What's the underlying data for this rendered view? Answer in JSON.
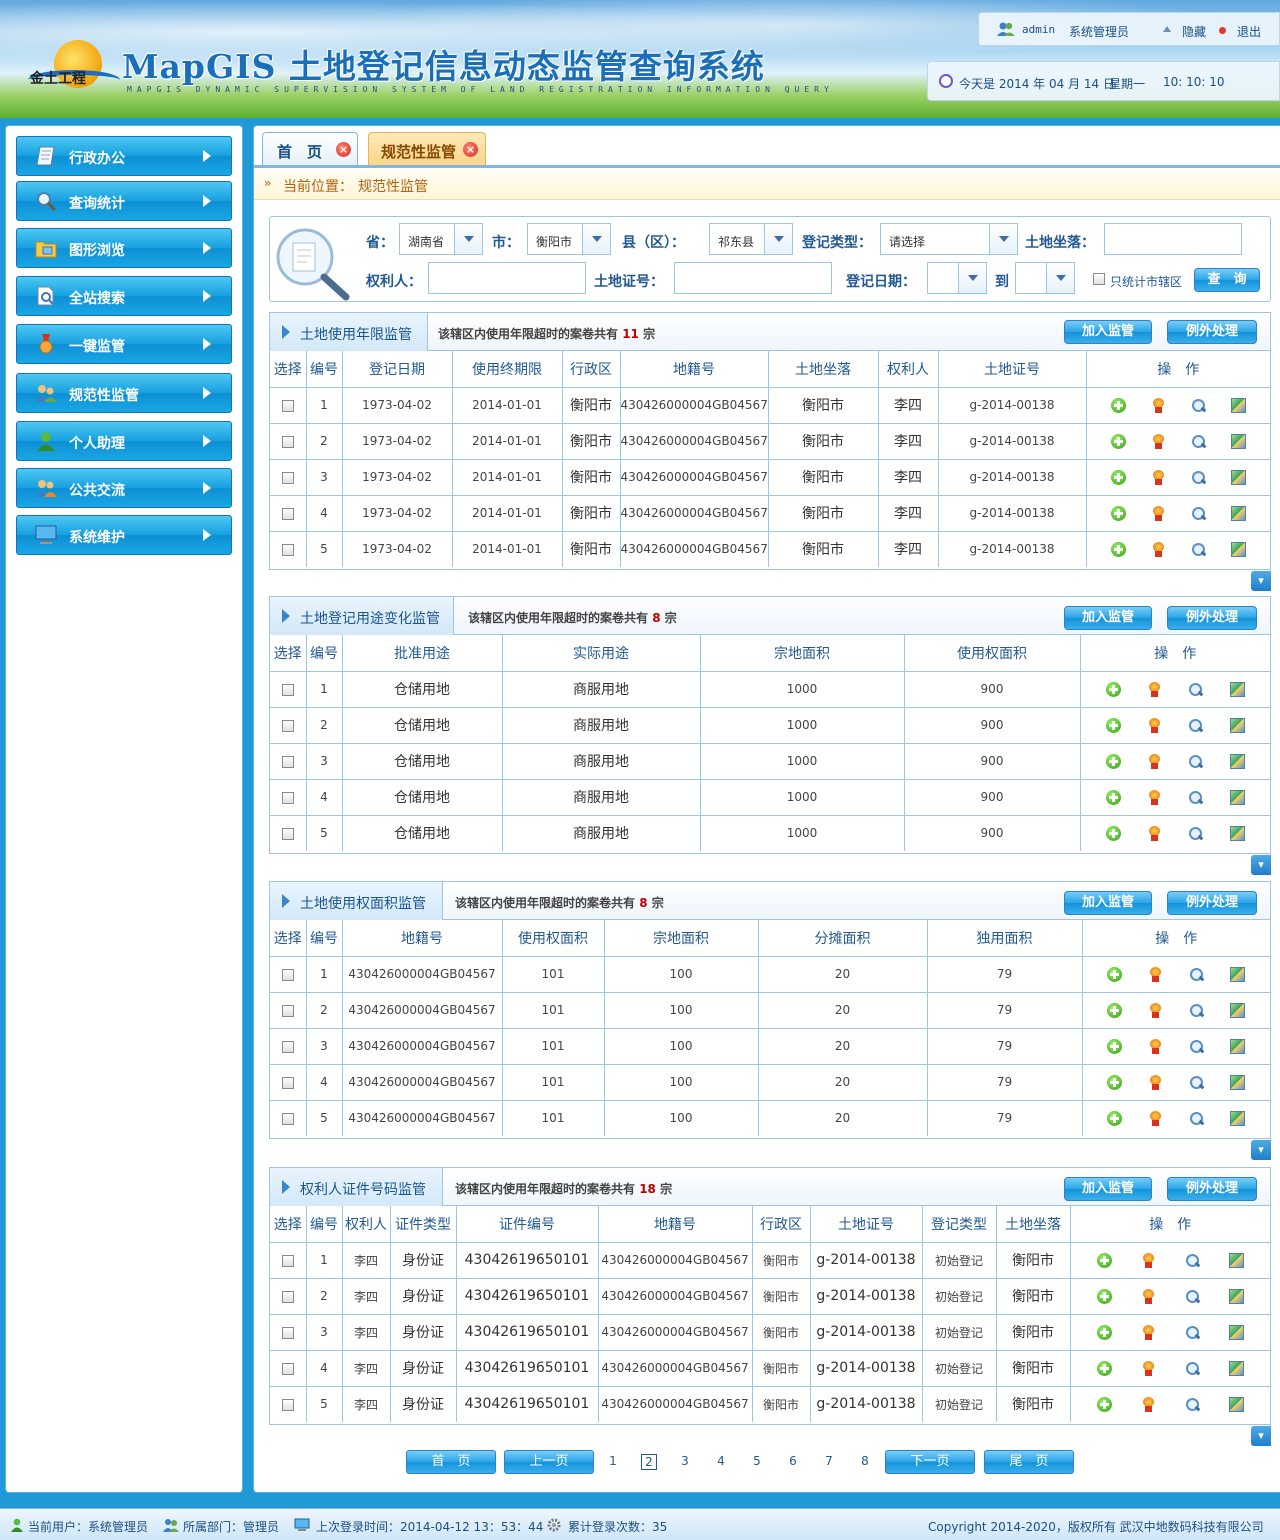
{
  "header": {
    "logo_text": "金土工程",
    "title": "MapGIS 土地登记信息动态监管查询系统",
    "subtitle": "MAPGIS DYNAMIC SUPERVISION SYSTEM OF LAND REGISTRATION INFORMATION QUERY",
    "user": "admin",
    "role": "系统管理员",
    "hide_label": "隐藏",
    "logout_label": "退出",
    "date_text": "今天是 2014 年 04 月 14 日",
    "weekday": "星期一",
    "time": "10: 10: 10"
  },
  "sidebar": {
    "items": [
      {
        "label": "行政办公",
        "icon": "document-icon"
      },
      {
        "label": "查询统计",
        "icon": "magnifier-icon"
      },
      {
        "label": "图形浏览",
        "icon": "folder-image-icon"
      },
      {
        "label": "全站搜索",
        "icon": "search-doc-icon"
      },
      {
        "label": "一键监管",
        "icon": "medal-icon"
      },
      {
        "label": "规范性监管",
        "icon": "users-icon"
      },
      {
        "label": "个人助理",
        "icon": "person-icon"
      },
      {
        "label": "公共交流",
        "icon": "group-icon"
      },
      {
        "label": "系统维护",
        "icon": "monitor-icon"
      }
    ]
  },
  "tabs": [
    {
      "label": "首　页"
    },
    {
      "label": "规范性监管"
    }
  ],
  "breadcrumb": {
    "prefix": "当前位置：",
    "current": "规范性监管"
  },
  "search": {
    "province_label": "省：",
    "province_value": "湖南省",
    "city_label": "市：",
    "city_value": "衡阳市",
    "county_label": "县（区）：",
    "county_value": "祁东县",
    "regtype_label": "登记类型：",
    "regtype_value": "请选择",
    "location_label": "土地坐落：",
    "owner_label": "权利人：",
    "cert_label": "土地证号：",
    "date_label": "登记日期：",
    "to_label": "到",
    "city_only_label": "只统计市辖区",
    "query_label": "查　询"
  },
  "panel_buttons": {
    "add": "加入监管",
    "exception": "例外处理"
  },
  "panels": [
    {
      "title": "土地使用年限监管",
      "info_prefix": "该辖区内使用年限超时的案卷共有",
      "count": "11",
      "info_suffix": "宗",
      "headers": [
        "选择",
        "编号",
        "登记日期",
        "使用终期限",
        "行政区",
        "地籍号",
        "土地坐落",
        "权利人",
        "土地证号",
        "操　作"
      ],
      "rows": [
        [
          "1",
          "1973-04-02",
          "2014-01-01",
          "衡阳市",
          "430426000004GB04567",
          "衡阳市",
          "李四",
          "g-2014-00138"
        ],
        [
          "2",
          "1973-04-02",
          "2014-01-01",
          "衡阳市",
          "430426000004GB04567",
          "衡阳市",
          "李四",
          "g-2014-00138"
        ],
        [
          "3",
          "1973-04-02",
          "2014-01-01",
          "衡阳市",
          "430426000004GB04567",
          "衡阳市",
          "李四",
          "g-2014-00138"
        ],
        [
          "4",
          "1973-04-02",
          "2014-01-01",
          "衡阳市",
          "430426000004GB04567",
          "衡阳市",
          "李四",
          "g-2014-00138"
        ],
        [
          "5",
          "1973-04-02",
          "2014-01-01",
          "衡阳市",
          "430426000004GB04567",
          "衡阳市",
          "李四",
          "g-2014-00138"
        ]
      ]
    },
    {
      "title": "土地登记用途变化监管",
      "info_prefix": "该辖区内使用年限超时的案卷共有",
      "count": "8",
      "info_suffix": "宗",
      "headers": [
        "选择",
        "编号",
        "批准用途",
        "实际用途",
        "宗地面积",
        "使用权面积",
        "操　作"
      ],
      "rows": [
        [
          "1",
          "仓储用地",
          "商服用地",
          "1000",
          "900"
        ],
        [
          "2",
          "仓储用地",
          "商服用地",
          "1000",
          "900"
        ],
        [
          "3",
          "仓储用地",
          "商服用地",
          "1000",
          "900"
        ],
        [
          "4",
          "仓储用地",
          "商服用地",
          "1000",
          "900"
        ],
        [
          "5",
          "仓储用地",
          "商服用地",
          "1000",
          "900"
        ]
      ]
    },
    {
      "title": "土地使用权面积监管",
      "info_prefix": "该辖区内使用年限超时的案卷共有",
      "count": "8",
      "info_suffix": "宗",
      "headers": [
        "选择",
        "编号",
        "地籍号",
        "使用权面积",
        "宗地面积",
        "分摊面积",
        "独用面积",
        "操　作"
      ],
      "rows": [
        [
          "1",
          "430426000004GB04567",
          "101",
          "100",
          "20",
          "79"
        ],
        [
          "2",
          "430426000004GB04567",
          "101",
          "100",
          "20",
          "79"
        ],
        [
          "3",
          "430426000004GB04567",
          "101",
          "100",
          "20",
          "79"
        ],
        [
          "4",
          "430426000004GB04567",
          "101",
          "100",
          "20",
          "79"
        ],
        [
          "5",
          "430426000004GB04567",
          "101",
          "100",
          "20",
          "79"
        ]
      ]
    },
    {
      "title": "权利人证件号码监管",
      "info_prefix": "该辖区内使用年限超时的案卷共有",
      "count": "18",
      "info_suffix": "宗",
      "headers": [
        "选择",
        "编号",
        "权利人",
        "证件类型",
        "证件编号",
        "地籍号",
        "行政区",
        "土地证号",
        "登记类型",
        "土地坐落",
        "操　作"
      ],
      "rows": [
        [
          "1",
          "李四",
          "身份证",
          "43042619650101",
          "430426000004GB04567",
          "衡阳市",
          "g-2014-00138",
          "初始登记",
          "衡阳市"
        ],
        [
          "2",
          "李四",
          "身份证",
          "43042619650101",
          "430426000004GB04567",
          "衡阳市",
          "g-2014-00138",
          "初始登记",
          "衡阳市"
        ],
        [
          "3",
          "李四",
          "身份证",
          "43042619650101",
          "430426000004GB04567",
          "衡阳市",
          "g-2014-00138",
          "初始登记",
          "衡阳市"
        ],
        [
          "4",
          "李四",
          "身份证",
          "43042619650101",
          "430426000004GB04567",
          "衡阳市",
          "g-2014-00138",
          "初始登记",
          "衡阳市"
        ],
        [
          "5",
          "李四",
          "身份证",
          "43042619650101",
          "430426000004GB04567",
          "衡阳市",
          "g-2014-00138",
          "初始登记",
          "衡阳市"
        ]
      ]
    }
  ],
  "pager": {
    "first": "首　页",
    "prev": "上一页",
    "pages": [
      "1",
      "2",
      "3",
      "4",
      "5",
      "6",
      "7",
      "8"
    ],
    "current": "2",
    "next": "下一页",
    "last": "尾　页"
  },
  "footer": {
    "user": "当前用户：系统管理员",
    "dept": "所属部门：管理员",
    "last_login": "上次登录时间：2014-04-12 13：53：44",
    "login_count": "累计登录次数：35",
    "copyright": "Copyright 2014-2020，版权所有 武汉中地数码科技有限公司"
  },
  "colors": {
    "accent": "#1f9ad6",
    "count_red": "#c00000",
    "crumb_orange": "#b8620a"
  }
}
